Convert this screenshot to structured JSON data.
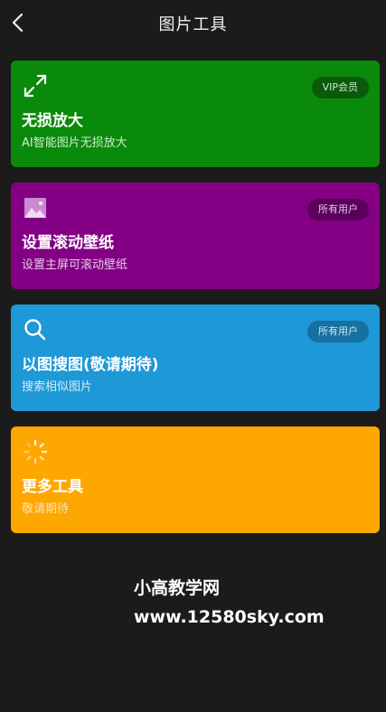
{
  "header": {
    "title": "图片工具",
    "back_icon": "chevron-left-icon"
  },
  "cards": [
    {
      "title": "无损放大",
      "subtitle": "AI智能图片无损放大",
      "badge": "VIP会员",
      "icon": "expand-icon",
      "bg_color": "#0a8a0a",
      "badge_bg": "#0b5a0b",
      "badge_color": "#cfe8cf",
      "subtitle_color": "#cdeccd"
    },
    {
      "title": "设置滚动壁纸",
      "subtitle": "设置主屏可滚动壁纸",
      "badge": "所有用户",
      "icon": "image-icon",
      "bg_color": "#830084",
      "badge_bg": "#5a005b",
      "badge_color": "#e8c8e8",
      "subtitle_color": "#e6c9e6"
    },
    {
      "title": "以图搜图(敬请期待)",
      "subtitle": "搜索相似图片",
      "badge": "所有用户",
      "icon": "search-icon",
      "bg_color": "#1e98d6",
      "badge_bg": "#1670a0",
      "badge_color": "#cfe6f4",
      "subtitle_color": "#d6ecf7"
    },
    {
      "title": "更多工具",
      "subtitle": "敬请期待",
      "badge": "",
      "icon": "loading-icon",
      "bg_color": "#fea700",
      "badge_bg": "",
      "badge_color": "",
      "subtitle_color": "#ffe3a8"
    }
  ],
  "watermark": {
    "line1": "小高教学网",
    "line2": "www.12580sky.com"
  }
}
